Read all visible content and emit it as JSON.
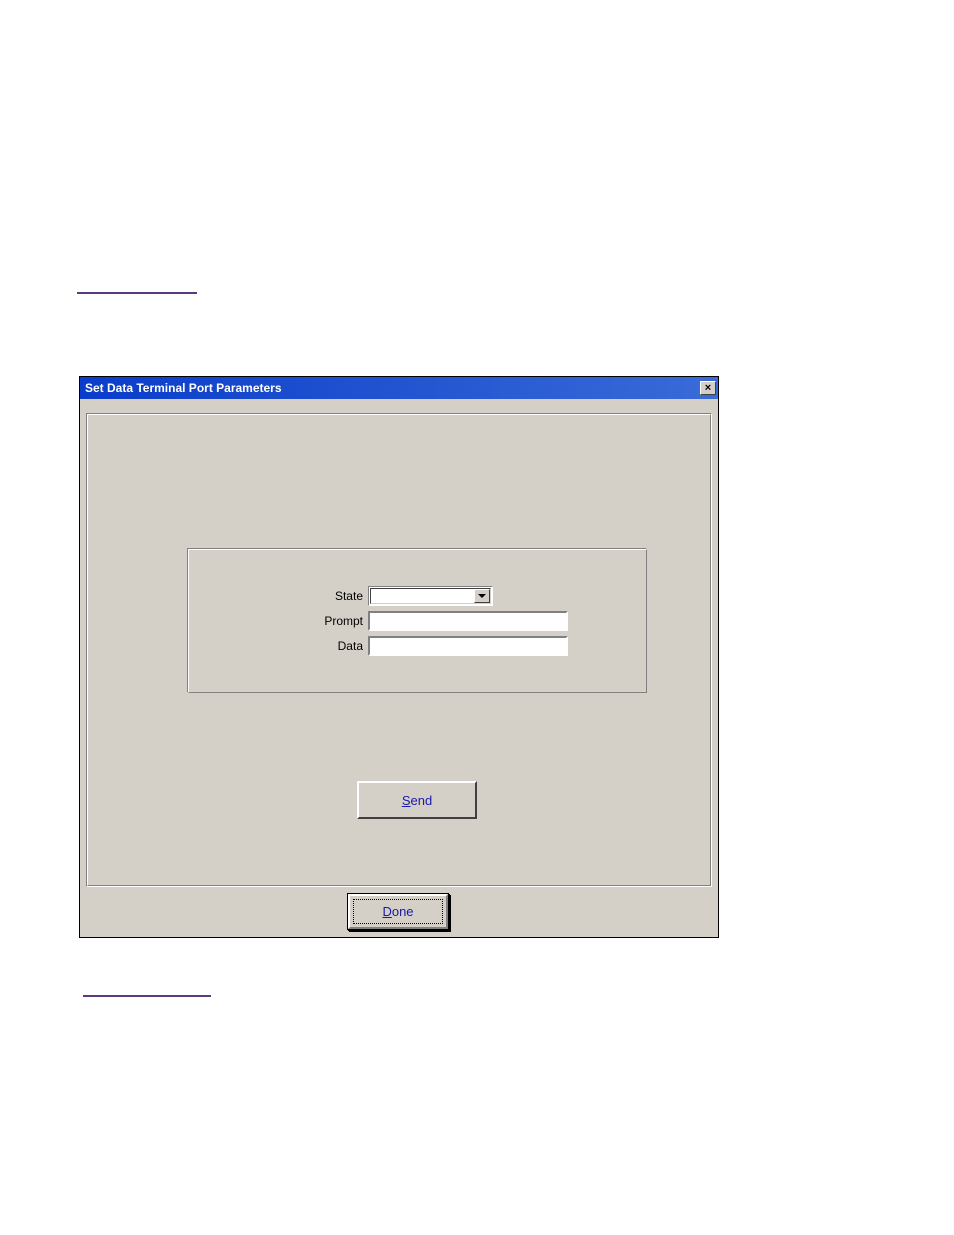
{
  "dialog": {
    "title": "Set Data Terminal Port Parameters",
    "close_icon": "×",
    "fields": {
      "state_label": "State",
      "state_value": "",
      "prompt_label": "Prompt",
      "prompt_value": "",
      "data_label": "Data",
      "data_value": ""
    },
    "buttons": {
      "send_mnemonic": "S",
      "send_rest": "end",
      "done_mnemonic": "D",
      "done_rest": "one"
    }
  }
}
